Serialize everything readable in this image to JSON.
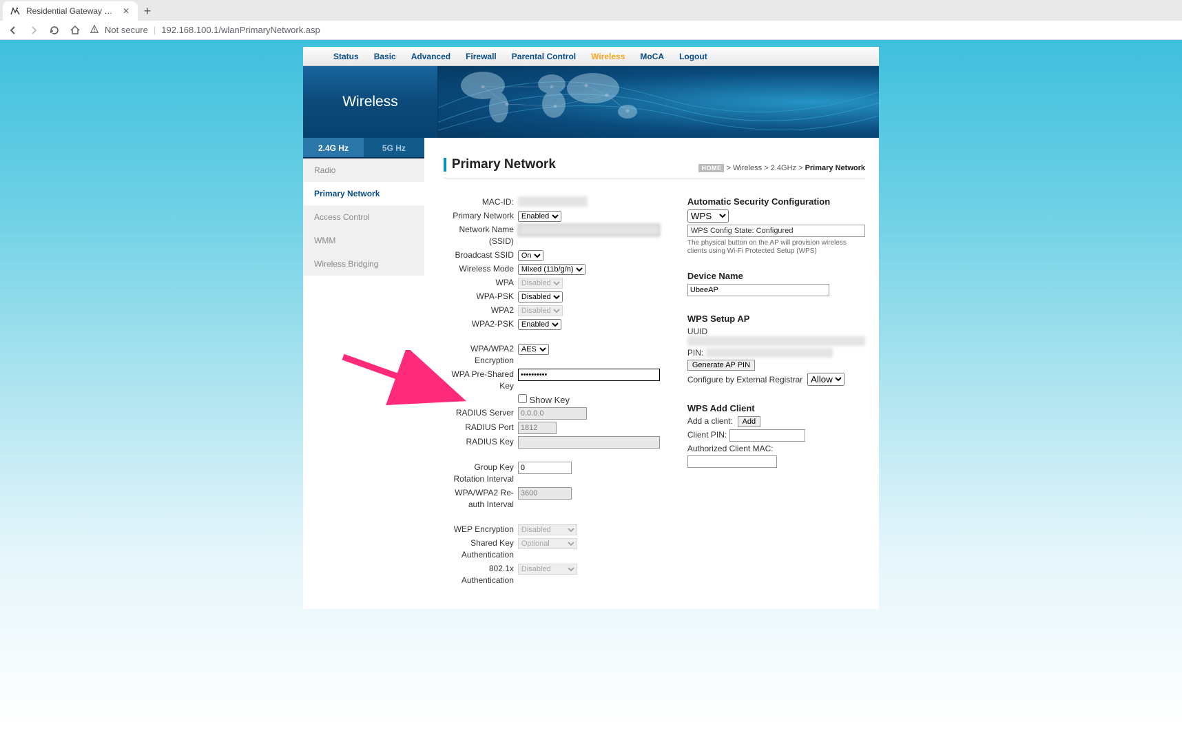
{
  "browser": {
    "tab_title": "Residential Gateway Configuratio",
    "not_secure_label": "Not secure",
    "url": "192.168.100.1/wlanPrimaryNetwork.asp"
  },
  "topnav": {
    "items": [
      "Status",
      "Basic",
      "Advanced",
      "Firewall",
      "Parental Control",
      "Wireless",
      "MoCA",
      "Logout"
    ],
    "active": "Wireless"
  },
  "banner": {
    "title": "Wireless"
  },
  "band_tabs": {
    "active": "2.4G Hz",
    "inactive": "5G Hz"
  },
  "side_menu": {
    "items": [
      "Radio",
      "Primary Network",
      "Access Control",
      "WMM",
      "Wireless Bridging"
    ],
    "active": "Primary Network"
  },
  "header": {
    "title": "Primary Network",
    "breadcrumb": {
      "home": "HOME",
      "parts": [
        "Wireless",
        "2.4GHz"
      ],
      "last": "Primary Network"
    }
  },
  "form": {
    "mac_id_label": "MAC-ID:",
    "mac_id_value": "",
    "primary_network_label": "Primary Network",
    "primary_network_value": "Enabled",
    "ssid_label": "Network Name (SSID)",
    "ssid_value": "",
    "broadcast_label": "Broadcast SSID",
    "broadcast_value": "On",
    "wmode_label": "Wireless Mode",
    "wmode_value": "Mixed (11b/g/n)",
    "wpa_label": "WPA",
    "wpa_value": "Disabled",
    "wpapsk_label": "WPA-PSK",
    "wpapsk_value": "Disabled",
    "wpa2_label": "WPA2",
    "wpa2_value": "Disabled",
    "wpa2psk_label": "WPA2-PSK",
    "wpa2psk_value": "Enabled",
    "enc_label": "WPA/WPA2 Encryption",
    "enc_value": "AES",
    "psk_label": "WPA Pre-Shared Key",
    "psk_value": "**********",
    "showkey_label": " Show Key",
    "radius_server_label": "RADIUS Server",
    "radius_server_value": "0.0.0.0",
    "radius_port_label": "RADIUS Port",
    "radius_port_value": "1812",
    "radius_key_label": "RADIUS Key",
    "radius_key_value": "",
    "gkri_label": "Group Key Rotation Interval",
    "gkri_value": "0",
    "reauth_label": "WPA/WPA2 Re-auth Interval",
    "reauth_value": "3600",
    "wep_label": "WEP Encryption",
    "wep_value": "Disabled",
    "skauth_label": "Shared Key Authentication",
    "skauth_value": "Optional",
    "dot1x_label": "802.1x Authentication",
    "dot1x_value": "Disabled"
  },
  "right": {
    "asc_title": "Automatic Security Configuration",
    "asc_value": "WPS",
    "wps_state_text": "WPS Config State: Configured",
    "help_text": "The physical button on the AP will provision wireless clients using Wi-Fi Protected Setup (WPS)",
    "devname_title": "Device Name",
    "devname_value": "UbeeAP",
    "setup_title": "WPS Setup AP",
    "uuid_label": "UUID",
    "uuid_value": "",
    "pin_label": "PIN:",
    "pin_value": "",
    "gen_pin_btn": "Generate AP PIN",
    "cfg_ext_label": "Configure by External Registrar",
    "cfg_ext_value": "Allow",
    "addclient_title": "WPS Add Client",
    "addclient_label": "Add a client:",
    "add_btn": "Add",
    "clientpin_label": "Client PIN:",
    "authmac_label": "Authorized Client MAC:"
  }
}
